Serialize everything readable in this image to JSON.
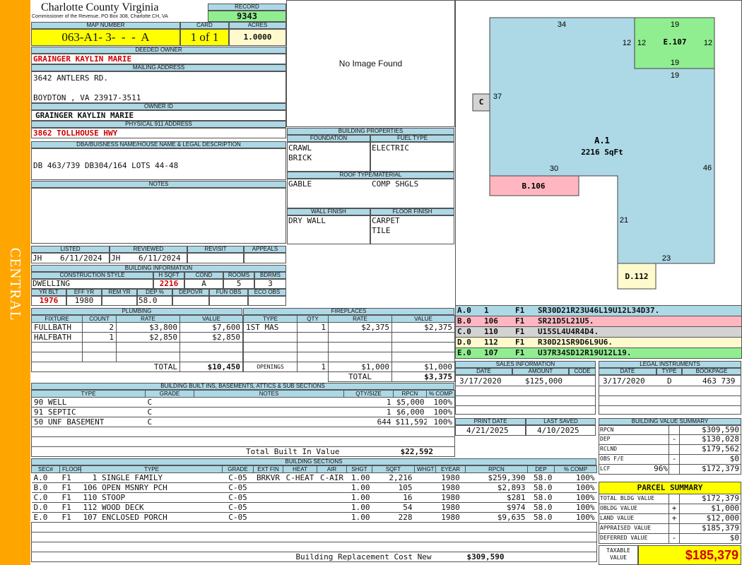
{
  "side_label": "CENTRAL",
  "header": {
    "county": "Charlotte County Virginia",
    "address": "Commissioner of the Revenue, PO Box 308, Charlotte CH, VA",
    "record_label": "RECORD",
    "record": "9343",
    "map_number_label": "MAP NUMBER",
    "map_number": "063-A1- 3-  -  -  A",
    "card_label": "CARD",
    "card": "1 of 1",
    "acres_label": "ACRES",
    "acres": "1.0000"
  },
  "owner": {
    "deeded_owner_label": "DEEDED OWNER",
    "deeded_owner": "GRAINGER KAYLIN MARIE",
    "mailing_address_label": "MAILING ADDRESS",
    "mailing_line1": "3642 ANTLERS RD.",
    "mailing_line2": "BOYDTON , VA 23917-3511",
    "owner_id_label": "OWNER ID",
    "owner_id": "GRAINGER KAYLIN MARIE",
    "physical_label": "PHYSICAL 911 ADDRESS",
    "physical": "3862 TOLLHOUSE HWY",
    "dba_label": "DBA/BUISNESS NAME/HOUSE NAME & LEGAL DESCRIPTION",
    "dba": "DB 463/739 DB304/164 LOTS 44-48",
    "notes_label": "NOTES"
  },
  "image_placeholder": "No Image Found",
  "building_properties": {
    "title": "BUILDING PROPERTIES",
    "foundation_label": "FOUNDATION",
    "foundation": [
      "CRAWL",
      "BRICK"
    ],
    "fuel_label": "FUEL TYPE",
    "fuel": "ELECTRIC",
    "roof_label": "ROOF TYPE/MATERIAL",
    "roof_type": "GABLE",
    "roof_material": "COMP SHGLS",
    "wall_label": "WALL FINISH",
    "wall": "DRY WALL",
    "floor_label": "FLOOR FINISH",
    "floor": [
      "CARPET",
      "TILE"
    ]
  },
  "review": {
    "listed_label": "LISTED",
    "listed_by": "JH",
    "listed_date": "6/11/2024",
    "reviewed_label": "REVIEWED",
    "reviewed_by": "JH",
    "reviewed_date": "6/11/2024",
    "revisit_label": "REVISIT",
    "appeals_label": "APPEALS"
  },
  "building_info": {
    "title": "BUILDING INFORMATION",
    "style_label": "CONSTRUCTION STYLE",
    "style": "DWELLING",
    "hsqft_label": "H SQFT",
    "hsqft": "2216",
    "cond_label": "COND",
    "cond": "A",
    "rooms_label": "ROOMS",
    "rooms": "5",
    "bdrms_label": "BDRMS",
    "bdrms": "3",
    "yrblt_label": "YR BLT",
    "yrblt": "1976",
    "effyr_label": "EFF YR",
    "effyr": "1980",
    "remyr_label": "REM YR",
    "dep_label": "DEP %",
    "dep": "58.0",
    "depovr_label": "DEPOVR",
    "funobs_label": "FUN OBS",
    "ecoobs_label": "ECO OBS"
  },
  "plumbing": {
    "title": "PLUMBING",
    "cols": [
      "FIXTURE",
      "COUNT",
      "RATE",
      "VALUE"
    ],
    "rows": [
      {
        "fixture": "FULLBATH",
        "count": "2",
        "rate": "$3,800",
        "value": "$7,600"
      },
      {
        "fixture": "HALFBATH",
        "count": "1",
        "rate": "$2,850",
        "value": "$2,850"
      }
    ],
    "total_label": "TOTAL",
    "total": "$10,450"
  },
  "fireplaces": {
    "title": "FIREPLACES",
    "cols": [
      "TYPE",
      "QTY",
      "RATE",
      "VALUE"
    ],
    "rows": [
      {
        "type": "1ST MAS",
        "qty": "1",
        "rate": "$2,375",
        "value": "$2,375"
      }
    ],
    "openings_label": "OPENINGS",
    "openings_qty": "1",
    "openings_rate": "$1,000",
    "openings_value": "$1,000",
    "total_label": "TOTAL",
    "total": "$3,375"
  },
  "built_ins": {
    "title": "BUILDING BUILT INS, BASEMENTS, ATTICS & SUB SECTIONS",
    "cols": [
      "TYPE",
      "GRADE",
      "NOTES",
      "QTY/SIZE",
      "RPCN",
      "% COMP"
    ],
    "rows": [
      {
        "type": "90 WELL",
        "grade": "C",
        "notes": "",
        "qty": "1",
        "rpcn": "$5,000",
        "comp": "100%"
      },
      {
        "type": "91 SEPTIC",
        "grade": "C",
        "notes": "",
        "qty": "1",
        "rpcn": "$6,000",
        "comp": "100%"
      },
      {
        "type": "50 UNF BASEMENT",
        "grade": "C",
        "notes": "",
        "qty": "644",
        "rpcn": "$11,592",
        "comp": "100%"
      }
    ],
    "total_label": "Total Built In Value",
    "total": "$22,592"
  },
  "sections": {
    "title": "BUILDING SECTIONS",
    "cols": [
      "SEC#",
      "FLOOR",
      "TYPE",
      "GRADE",
      "EXT FIN",
      "HEAT",
      "AIR",
      "SHGT",
      "SQFT",
      "WHGT",
      "EYEAR",
      "RPCN",
      "DEP",
      "% COMP"
    ],
    "rows": [
      {
        "sec": "A.0",
        "floor": "F1",
        "type": "  1 SINGLE FAMILY",
        "grade": "C-05",
        "ext": "BRKVR",
        "heat": "C-HEAT",
        "air": "C-AIR",
        "shgt": "1.00",
        "sqft": "2,216",
        "whgt": "",
        "eyear": "1980",
        "rpcn": "$259,390",
        "dep": "58.0",
        "comp": "100%"
      },
      {
        "sec": "B.0",
        "floor": "F1",
        "type": "106 OPEN MSNRY PCH",
        "grade": "C-05",
        "ext": "",
        "heat": "",
        "air": "",
        "shgt": "1.00",
        "sqft": "105",
        "whgt": "",
        "eyear": "1980",
        "rpcn": "$2,893",
        "dep": "58.0",
        "comp": "100%"
      },
      {
        "sec": "C.0",
        "floor": "F1",
        "type": "110 STOOP",
        "grade": "C-05",
        "ext": "",
        "heat": "",
        "air": "",
        "shgt": "1.00",
        "sqft": "16",
        "whgt": "",
        "eyear": "1980",
        "rpcn": "$281",
        "dep": "58.0",
        "comp": "100%"
      },
      {
        "sec": "D.0",
        "floor": "F1",
        "type": "112 WOOD DECK",
        "grade": "C-05",
        "ext": "",
        "heat": "",
        "air": "",
        "shgt": "1.00",
        "sqft": "54",
        "whgt": "",
        "eyear": "1980",
        "rpcn": "$974",
        "dep": "58.0",
        "comp": "100%"
      },
      {
        "sec": "E.0",
        "floor": "F1",
        "type": "107 ENCLOSED PORCH",
        "grade": "C-05",
        "ext": "",
        "heat": "",
        "air": "",
        "shgt": "1.00",
        "sqft": "228",
        "whgt": "",
        "eyear": "1980",
        "rpcn": "$9,635",
        "dep": "58.0",
        "comp": "100%"
      }
    ],
    "replacement_label": "Building Replacement Cost New",
    "replacement": "$309,590"
  },
  "sketch": {
    "labels": {
      "main": "A.1",
      "main_area": "2216 SqFt",
      "b": "B.106",
      "c": "C",
      "d": "D.112",
      "e": "E.107"
    },
    "dims": {
      "top": "34",
      "e_top": "19",
      "e_left1": "12",
      "e_left2": "12",
      "e_right": "12",
      "e_bottom": "19",
      "e_below": "19",
      "left": "37",
      "right": "46",
      "inner": "30",
      "step": "21",
      "bottom": "23"
    },
    "colors": {
      "main": "#add8e6",
      "b": "#ffb6c1",
      "c": "#d3d3d3",
      "d": "#fffacd",
      "e": "#90ee90"
    }
  },
  "legend_rows": [
    {
      "sec": "A.0",
      "n": "1",
      "f": "F1",
      "code": "SR30D21R23U46L19U12L34D37.",
      "color": "#add8e6"
    },
    {
      "sec": "B.0",
      "n": "106",
      "f": "F1",
      "code": "SR21D5L21U5.",
      "color": "#ffb6c1"
    },
    {
      "sec": "C.0",
      "n": "110",
      "f": "F1",
      "code": "U15SL4U4R4D4.",
      "color": "#d3d3d3"
    },
    {
      "sec": "D.0",
      "n": "112",
      "f": "F1",
      "code": "R30D21SR9D6L9U6.",
      "color": "#fffacd"
    },
    {
      "sec": "E.0",
      "n": "107",
      "f": "F1",
      "code": "U37R34SD12R19U12L19.",
      "color": "#90ee90"
    }
  ],
  "sales": {
    "title": "SALES INFORMATION",
    "cols": [
      "DATE",
      "AMOUNT",
      "CODE"
    ],
    "date": "3/17/2020",
    "amount": "$125,000",
    "code": ""
  },
  "legal": {
    "title": "LEGAL INSTRUMENTS",
    "cols": [
      "DATE",
      "TYPE",
      "BOOKPAGE"
    ],
    "date": "3/17/2020",
    "type": "D",
    "bookpage": "463 739"
  },
  "print_info": {
    "print_label": "PRINT DATE",
    "print_date": "4/21/2025",
    "saved_label": "LAST SAVED",
    "saved_date": "4/10/2025"
  },
  "value_summary": {
    "title": "BUILDING VALUE SUMMARY",
    "rows": [
      {
        "label": "RPCN",
        "sign": "",
        "pct": "",
        "value": "$309,590"
      },
      {
        "label": "DEP",
        "sign": "-",
        "pct": "",
        "value": "$130,028"
      },
      {
        "label": "RCLND",
        "sign": "",
        "pct": "",
        "value": "$179,562"
      },
      {
        "label": "OBS F/E",
        "sign": "-",
        "pct": "",
        "value": "$0"
      },
      {
        "label": "LCF",
        "sign": "",
        "pct": "96%",
        "value": "$172,379"
      }
    ]
  },
  "parcel": {
    "title": "PARCEL SUMMARY",
    "rows": [
      {
        "label": "TOTAL BLDG VALUE",
        "sign": "",
        "value": "$172,379"
      },
      {
        "label": "OBLDG VALUE",
        "sign": "+",
        "value": "$1,000"
      },
      {
        "label": "LAND VALUE",
        "sign": "+",
        "value": "$12,000"
      },
      {
        "label": "APPRAISED VALUE",
        "sign": "",
        "value": "$185,379"
      },
      {
        "label": "DEFERRED VALUE",
        "sign": "-",
        "value": "$0"
      }
    ],
    "taxable_label1": "TAXABLE",
    "taxable_label2": "VALUE",
    "taxable": "$185,379"
  }
}
